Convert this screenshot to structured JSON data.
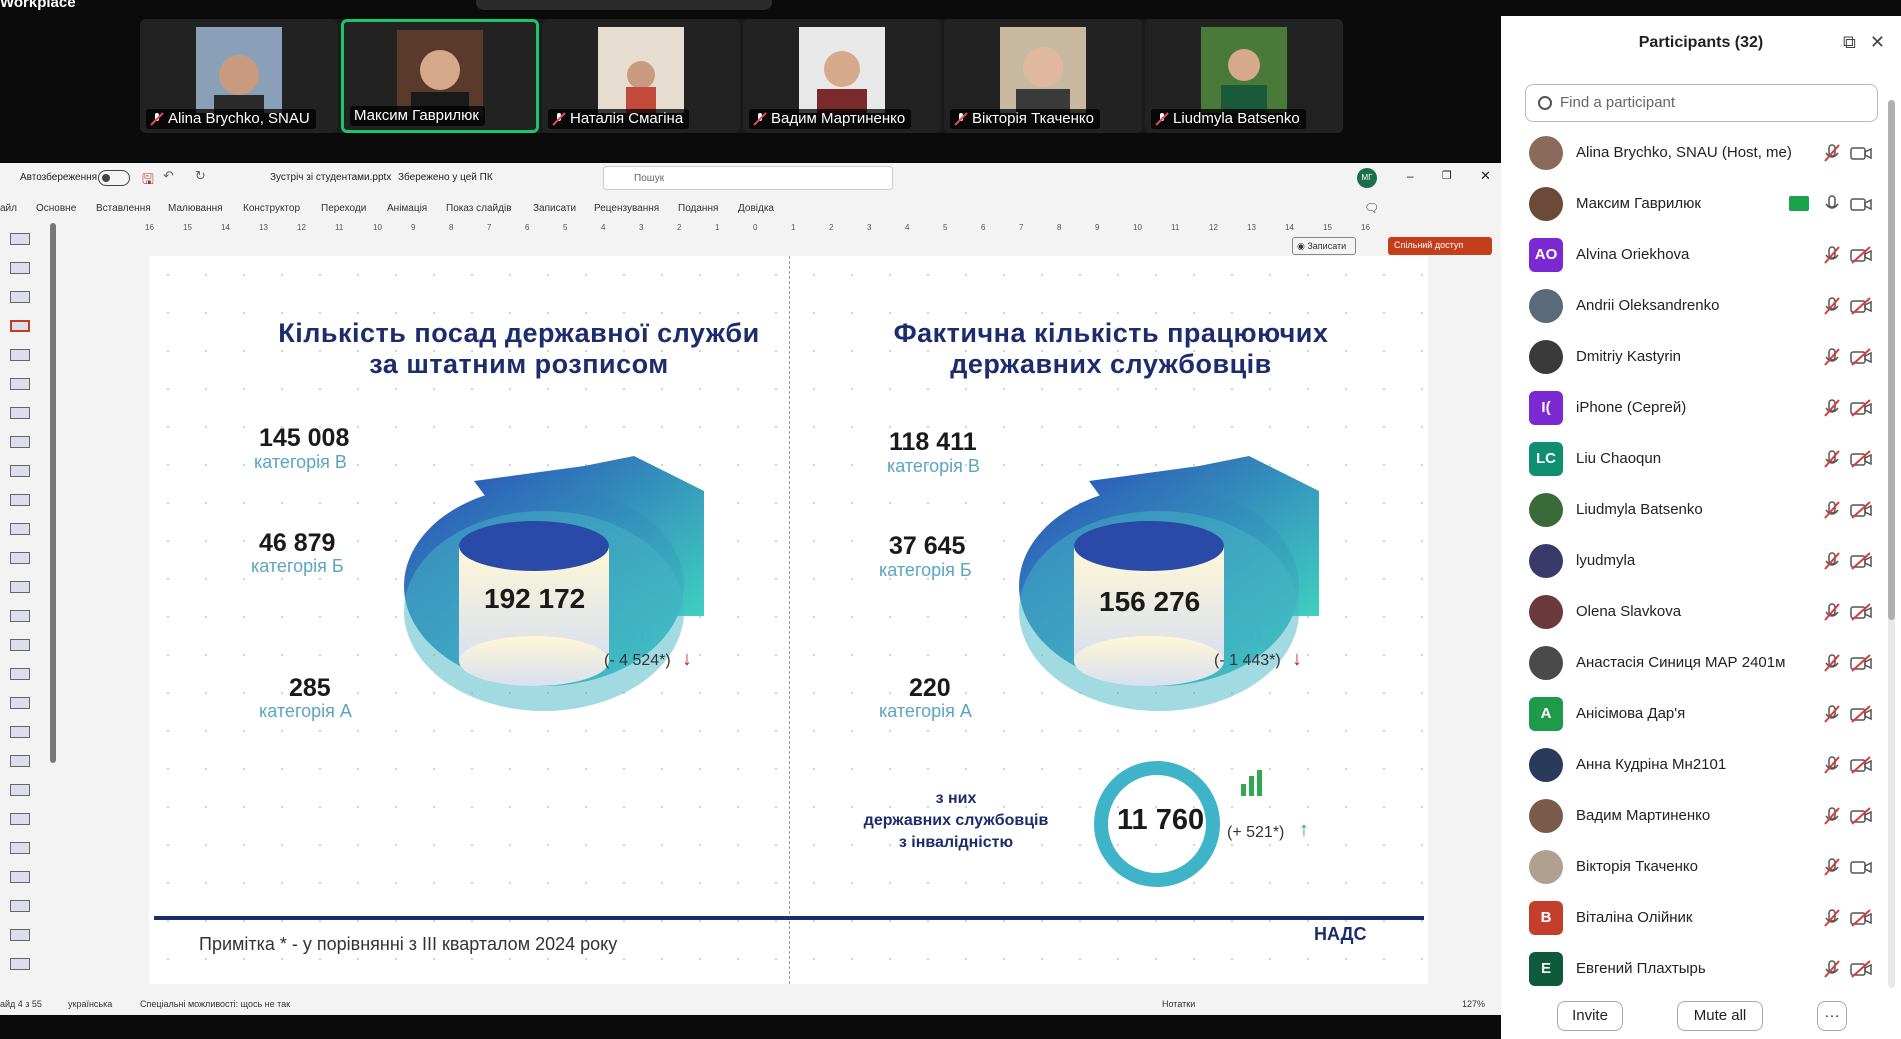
{
  "app": {
    "title": "Workplace"
  },
  "video_strip": [
    {
      "name": "Alina Brychko, SNAU",
      "muted": true
    },
    {
      "name": "Максим Гаврилюк",
      "muted": false,
      "active": true
    },
    {
      "name": "Наталія Смагіна",
      "muted": true
    },
    {
      "name": "Вадим Мартиненко",
      "muted": true
    },
    {
      "name": "Вікторія Ткаченко",
      "muted": true
    },
    {
      "name": "Liudmyla Batsenko",
      "muted": true
    }
  ],
  "ppt": {
    "autosave_label": "Автозбереження",
    "file_name": "Зустріч зі студентами.pptx",
    "save_state": "Збережено у цей ПК",
    "search_placeholder": "Пошук",
    "user_initials": "МГ",
    "menu": [
      "айл",
      "Основне",
      "Вставлення",
      "Малювання",
      "Конструктор",
      "Переходи",
      "Анімація",
      "Показ слайдів",
      "Записати",
      "Рецензування",
      "Подання",
      "Довідка"
    ],
    "record_label": "Записати",
    "share_label": "Спільний доступ",
    "ruler": [
      "16",
      "15",
      "14",
      "13",
      "12",
      "11",
      "10",
      "9",
      "8",
      "7",
      "6",
      "5",
      "4",
      "3",
      "2",
      "1",
      "0",
      "1",
      "2",
      "3",
      "4",
      "5",
      "6",
      "7",
      "8",
      "9",
      "10",
      "11",
      "12",
      "13",
      "14",
      "15",
      "16"
    ],
    "status": {
      "slide": "айд 4 з 55",
      "language": "українська",
      "accessibility": "Спеціальні можливості: щось не так",
      "notes": "Нотатки",
      "zoom": "127%"
    }
  },
  "slide": {
    "left": {
      "title_line1": "Кількість посад державної служби",
      "title_line2": "за штатним розписом",
      "cat_b_value": "145 008",
      "cat_b_label": "категорія В",
      "cat_b2_value": "46 879",
      "cat_b2_label": "категорія Б",
      "cat_a_value": "285",
      "cat_a_label": "категорія А",
      "total": "192 172",
      "delta": "(- 4 524*)"
    },
    "right": {
      "title_line1": "Фактична кількість працюючих",
      "title_line2": "державних службовців",
      "cat_b_value": "118 411",
      "cat_b_label": "категорія В",
      "cat_b2_value": "37 645",
      "cat_b2_label": "категорія Б",
      "cat_a_value": "220",
      "cat_a_label": "категорія А",
      "total": "156 276",
      "delta": "(- 1 443*)",
      "inv_line1": "з них",
      "inv_line2": "державних службовців",
      "inv_line3": "з інвалідністю",
      "inv_value": "11 760",
      "inv_delta": "(+ 521*)"
    },
    "note": "Примітка * - у порівнянні з ІІІ кварталом 2024 року",
    "logo": "НАДС",
    "colors": {
      "title": "#1c2d6e",
      "accent": "#3fb3c8",
      "down": "#c0282d",
      "up": "#2fa84f"
    }
  },
  "participants": {
    "title": "Participants (32)",
    "search_placeholder": "Find a participant",
    "list": [
      {
        "name": "Alina Brychko, SNAU (Host, me)",
        "avatar": "photo",
        "color": "#8a6a5a",
        "cam": "on"
      },
      {
        "name": "Максим Гаврилюк",
        "avatar": "photo",
        "color": "#6b4a3a",
        "cam": "on",
        "mic": "on",
        "sharing": true
      },
      {
        "name": "Alvina Oriekhova",
        "avatar": "AO",
        "color": "#7b2ad1"
      },
      {
        "name": "Andrii Oleksandrenko",
        "avatar": "photo",
        "color": "#5a6a7a"
      },
      {
        "name": "Dmitriy Kastyrin",
        "avatar": "photo",
        "color": "#3a3a3a"
      },
      {
        "name": "iPhone (Сергей)",
        "avatar": "I(",
        "color": "#7b2ad1"
      },
      {
        "name": "Liu Chaoqun",
        "avatar": "LC",
        "color": "#0f8f6f"
      },
      {
        "name": "Liudmyla Batsenko",
        "avatar": "photo",
        "color": "#3a6a3a"
      },
      {
        "name": "lyudmyla",
        "avatar": "photo",
        "color": "#3a3a6a"
      },
      {
        "name": "Olena Slavkova",
        "avatar": "photo",
        "color": "#6a3a3a"
      },
      {
        "name": "Анастасія Синиця МАР 2401м",
        "avatar": "photo",
        "color": "#4a4a4a"
      },
      {
        "name": "Анісімова Дар'я",
        "avatar": "A",
        "color": "#1e9a4a"
      },
      {
        "name": "Анна Кудріна Мн2101",
        "avatar": "photo",
        "color": "#2a3a5a"
      },
      {
        "name": "Вадим Мартиненко",
        "avatar": "photo",
        "color": "#7a5a4a"
      },
      {
        "name": "Вікторія Ткаченко",
        "avatar": "photo",
        "color": "#b0a090",
        "cam": "on"
      },
      {
        "name": "Віталіна Олійник",
        "avatar": "B",
        "color": "#c43e2c"
      },
      {
        "name": "Евгений Плахтырь",
        "avatar": "E",
        "color": "#0f5a3a"
      }
    ],
    "invite_label": "Invite",
    "mute_all_label": "Mute all",
    "more_label": "···"
  }
}
